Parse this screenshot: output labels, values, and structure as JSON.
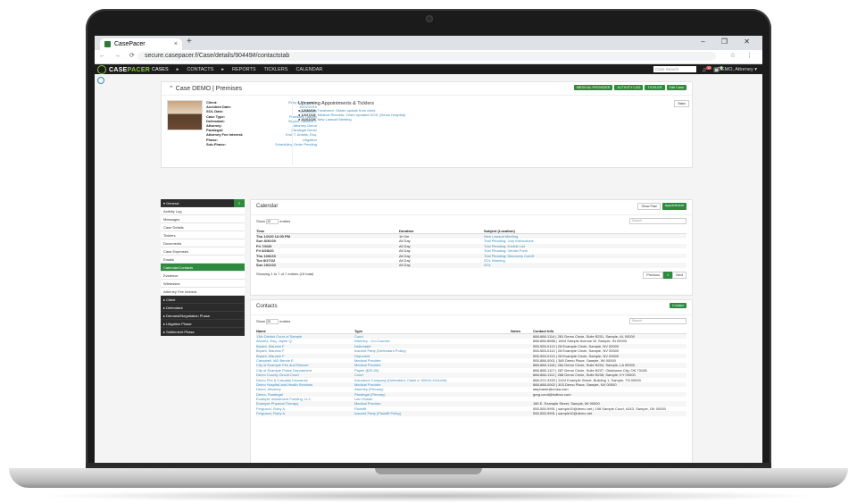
{
  "browser": {
    "tab_title": "CasePacer",
    "tab_close": "×",
    "new_tab": "+",
    "window_controls": "– ❐ ✕",
    "nav_buttons": "← → ⟳",
    "url": "secure.casepacer.f/Case/details/90449#/contactstab",
    "addr_icons": "☆ ⋮"
  },
  "app": {
    "logo_case": "CASE",
    "logo_pacer": "PACER",
    "menu": [
      "CASES",
      "CONTACTS",
      "REPORTS",
      "TICKLERS",
      "CALENDAR"
    ],
    "menu_sep": "▸",
    "case_search_placeholder": "Case Search",
    "badge_red": "12",
    "badge_green": "4",
    "user": "DEMO, Attorney ▾"
  },
  "case": {
    "title": "⌃ Case DEMO | Premises",
    "buttons": [
      "MEDICAL PROVIDER",
      "ACTIVITY LOG",
      "TICKLER",
      "Edit Case"
    ],
    "fields": [
      {
        "k": "Client:",
        "v": "Ruby A. Ferguson"
      },
      {
        "k": "Accident Date:",
        "v": "10/02/2019"
      },
      {
        "k": "SOL Date:",
        "v": "10/02/2022"
      },
      {
        "k": "Case Type:",
        "v": "Premises Liability"
      },
      {
        "k": "Defendant:",
        "v": "Bryant, Maurice F"
      },
      {
        "k": "Attorney:",
        "v": "Attorney Demo"
      },
      {
        "k": "Paralegal:",
        "v": "Paralegal Demo"
      },
      {
        "k": "Attorney Fee Interest:",
        "v": "Emil T. Amstis, Esq."
      },
      {
        "k": "Phase:",
        "v": "Litigation"
      },
      {
        "k": "Sub-Phase:",
        "v": "Scheduling Order Pending"
      }
    ],
    "appts_title": "Upcoming Appointments & Ticklers",
    "tasks_btn": "Tasks",
    "appts": [
      {
        "d": "12/30/19:",
        "t": "Treatment: Obtain update from client."
      },
      {
        "d": "12/27/19:",
        "t": "Medical Records: Order updated DOS. [Demo Hospital]"
      },
      {
        "d": "01/02/20:",
        "t": "New Lawsuit Meeting"
      }
    ]
  },
  "sidebar": {
    "general": "▾ General",
    "items": [
      "Activity Log",
      "Messages",
      "Case Details",
      "Ticklers",
      "Documents",
      "Case Expenses",
      "Emails",
      "Calendar/Contacts",
      "Evidence",
      "Witnesses",
      "Attorney Fee Interest"
    ],
    "groups": [
      "▸ Client",
      "▸ Defendant",
      "▸ Demand/Negotiation Phase",
      "▸ Litigation Phase",
      "▸ Settlement Phase"
    ]
  },
  "calendar": {
    "title": "Calendar",
    "btn_past": "Show Past",
    "btn_appt": "Appointment",
    "show": "Show",
    "entries": "entries",
    "page_size": "10",
    "search": "Search",
    "headers": [
      "Time",
      "Duration",
      "Subject (Location)"
    ],
    "rows": [
      [
        "Thu 1/2/20 12:00 PM",
        "1h 0m",
        "New Lawsuit Meeting"
      ],
      [
        "Sun 8/30/20",
        "All Day",
        "Trial Pleading: Jury Instructions"
      ],
      [
        "Fri 7/3/20",
        "All Day",
        "Trial Pleading: Exhibit List"
      ],
      [
        "Fri 8/28/20",
        "All Day",
        "Trial Pleading: Verdict Form"
      ],
      [
        "Thu 10/6/20",
        "All Day",
        "Trial Pleading: Discovery Cutoff"
      ],
      [
        "Tue 8/27/22",
        "All Day",
        "SOL Warning"
      ],
      [
        "Sun 10/2/22",
        "All Day",
        "SOL"
      ]
    ],
    "footer": "Showing 1 to 7 of 7 entries (15 total)",
    "pager": [
      "Previous",
      "1",
      "Next"
    ]
  },
  "contacts": {
    "title": "Contacts",
    "btn_contact": "Contact",
    "show": "Show",
    "entries": "entries",
    "page_size": "25",
    "search": "Search",
    "headers": [
      "Name",
      "Type",
      "Notes",
      "Contact Info"
    ],
    "rows": [
      [
        "13th District Court of Sample",
        "Court",
        "",
        "888-888-1114 | 281 Demo Circle, Suite B201, Sample, AL 00000"
      ],
      [
        "Alvarez, Esq. Jayne Q.",
        "Attorney - Co-Counsel",
        "",
        "888-888-8888 | 1804 Sample Avenue W, Sample, IN 00000"
      ],
      [
        "Bryant, Maurice F",
        "Defendant",
        "",
        "555-555-0113 | 28 Example Circle, Sample, NV 00000"
      ],
      [
        "Bryant, Maurice F",
        "Insured Party (Defendant Policy)",
        "",
        "555-555-0113 | 28 Example Circle, Sample, NV 00000"
      ],
      [
        "Bryant, Maurice F",
        "Deponent",
        "",
        "555-555-0113 | 28 Example Circle, Sample, NV 00000"
      ],
      [
        "Campbell, MD Bernie E",
        "Medical Provider",
        "",
        "555-888-0001 | 380 Demo Place, Sample, WI 00000"
      ],
      [
        "City of Example Fire and Rescue",
        "Medical Provider",
        "",
        "888-888-1118 | 284 Demo Circle, Suite B204, Sample, LA 00000"
      ],
      [
        "City of Example Police Department",
        "Payee ($25.00)",
        "",
        "888-888-1117 | 287 Demo Circle, Suite B207, Oklahoma City, OK 73108"
      ],
      [
        "Demo County Circuit Court",
        "Court",
        "",
        "888-888-1112 | 288 Demo Circle, Suite B208, Sample, KY 00000"
      ],
      [
        "Demo Fire & Casualty Insurance",
        "Insurance Company (Defendant, Claim #: 00000-1114444)",
        "",
        "888-222-3333 | 2424 Example Street, Building 1, Sample, TN 00000"
      ],
      [
        "Demo Hospital and Health Services",
        "Medical Provider",
        "",
        "888-888-0002 | 303 Demo Place, Sample, NV 00000"
      ],
      [
        "Demo, Attorney",
        "Attorney (Primary)",
        "",
        "stephanie@cmsa.com"
      ],
      [
        "Demo, Paralegal",
        "Paralegal (Primary)",
        "",
        "greg.cond@hotbox.com"
      ],
      [
        "Example Investment Funding, LLC",
        "Lien Holder",
        "",
        ""
      ],
      [
        "Example Physical Therapy",
        "Medical Provider",
        "",
        "180 E. Example Street, Sample, MI 00000"
      ],
      [
        "Ferguson, Ruby A.",
        "Plaintiff",
        "",
        "555-555-9991 | sample10@demo.net | 198 Sample Court, #243, Sample, OK 00000"
      ],
      [
        "Ferguson, Ruby A.",
        "Insured Party (Plaintiff Policy)",
        "",
        "555-555-9991 | sample10@demo.net"
      ]
    ]
  }
}
